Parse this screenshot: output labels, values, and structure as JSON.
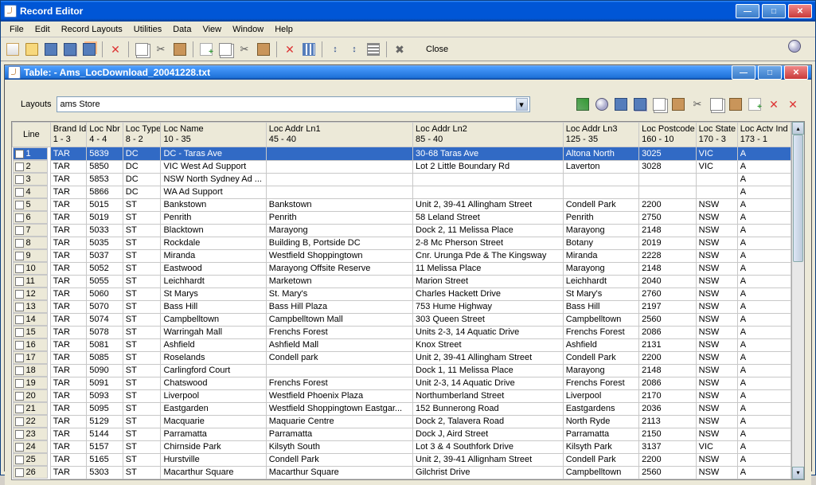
{
  "outerTitle": "Record Editor",
  "innerTitle": "Table: - Ams_LocDownload_20041228.txt",
  "menus": [
    "File",
    "Edit",
    "Record Layouts",
    "Utilities",
    "Data",
    "View",
    "Window",
    "Help"
  ],
  "toolbarGroups": [
    [
      "new-doc",
      "open-folder",
      "save",
      "save-as",
      "export"
    ],
    [
      "delete"
    ],
    [
      "copy",
      "cut",
      "paste"
    ],
    [
      "new-record",
      "copy-record",
      "cut-record",
      "paste-record"
    ],
    [
      "delete-record",
      "column-select"
    ],
    [
      "sort-asc",
      "sort-desc",
      "auto-fit"
    ],
    [
      "options"
    ]
  ],
  "closeLabel": "Close",
  "layoutsLabel": "Layouts",
  "layoutsValue": "ams Store",
  "rightTools": [
    "tree-view",
    "find",
    "save",
    "save-as",
    "copy",
    "paste",
    "cut",
    "copy-record",
    "paste-record",
    "new-record",
    "delete-record",
    "delete"
  ],
  "columns": [
    {
      "label": "Line",
      "sub": "",
      "w": 44
    },
    {
      "label": "Brand Id",
      "sub": "1 - 3",
      "w": 42
    },
    {
      "label": "Loc Nbr",
      "sub": "4 - 4",
      "w": 42
    },
    {
      "label": "Loc Type",
      "sub": "8 - 2",
      "w": 44
    },
    {
      "label": "Loc Name",
      "sub": "10 - 35",
      "w": 122
    },
    {
      "label": "Loc Addr Ln1",
      "sub": "45 - 40",
      "w": 170
    },
    {
      "label": "Loc Addr Ln2",
      "sub": "85 - 40",
      "w": 174
    },
    {
      "label": "Loc Addr Ln3",
      "sub": "125 - 35",
      "w": 88
    },
    {
      "label": "Loc Postcode",
      "sub": "160 - 10",
      "w": 66
    },
    {
      "label": "Loc State",
      "sub": "170 - 3",
      "w": 48
    },
    {
      "label": "Loc Actv Ind",
      "sub": "173 - 1",
      "w": 62
    }
  ],
  "rows": [
    {
      "n": 1,
      "sel": true,
      "c": [
        "TAR",
        "5839",
        "DC",
        "DC - Taras Ave",
        "",
        "30-68 Taras Ave",
        "Altona North",
        "3025",
        "VIC",
        "A"
      ]
    },
    {
      "n": 2,
      "c": [
        "TAR",
        "5850",
        "DC",
        "VIC West Ad Support",
        "",
        "Lot 2 Little Boundary Rd",
        "Laverton",
        "3028",
        "VIC",
        "A"
      ]
    },
    {
      "n": 3,
      "c": [
        "TAR",
        "5853",
        "DC",
        "NSW North Sydney Ad ...",
        "",
        "",
        "",
        "",
        "",
        "A"
      ]
    },
    {
      "n": 4,
      "c": [
        "TAR",
        "5866",
        "DC",
        "WA Ad Support",
        "",
        "",
        "",
        "",
        "",
        "A"
      ]
    },
    {
      "n": 5,
      "c": [
        "TAR",
        "5015",
        "ST",
        "Bankstown",
        "Bankstown",
        "Unit 2, 39-41 Allingham Street",
        "Condell Park",
        "2200",
        "NSW",
        "A"
      ]
    },
    {
      "n": 6,
      "c": [
        "TAR",
        "5019",
        "ST",
        "Penrith",
        "Penrith",
        "58 Leland Street",
        "Penrith",
        "2750",
        "NSW",
        "A"
      ]
    },
    {
      "n": 7,
      "c": [
        "TAR",
        "5033",
        "ST",
        "Blacktown",
        "Marayong",
        "Dock 2, 11 Melissa Place",
        "Marayong",
        "2148",
        "NSW",
        "A"
      ]
    },
    {
      "n": 8,
      "c": [
        "TAR",
        "5035",
        "ST",
        "Rockdale",
        "Building B,  Portside DC",
        "2-8 Mc Pherson Street",
        "Botany",
        "2019",
        "NSW",
        "A"
      ]
    },
    {
      "n": 9,
      "c": [
        "TAR",
        "5037",
        "ST",
        "Miranda",
        "Westfield Shoppingtown",
        "Cnr. Urunga Pde & The Kingsway",
        "Miranda",
        "2228",
        "NSW",
        "A"
      ]
    },
    {
      "n": 10,
      "c": [
        "TAR",
        "5052",
        "ST",
        "Eastwood",
        "Marayong Offsite Reserve",
        "11 Melissa Place",
        "Marayong",
        "2148",
        "NSW",
        "A"
      ]
    },
    {
      "n": 11,
      "c": [
        "TAR",
        "5055",
        "ST",
        "Leichhardt",
        "Marketown",
        "Marion Street",
        "Leichhardt",
        "2040",
        "NSW",
        "A"
      ]
    },
    {
      "n": 12,
      "c": [
        "TAR",
        "5060",
        "ST",
        "St Marys",
        "St. Mary's",
        "Charles Hackett Drive",
        "St Mary's",
        "2760",
        "NSW",
        "A"
      ]
    },
    {
      "n": 13,
      "c": [
        "TAR",
        "5070",
        "ST",
        "Bass Hill",
        "Bass Hill Plaza",
        "753 Hume Highway",
        "Bass Hill",
        "2197",
        "NSW",
        "A"
      ]
    },
    {
      "n": 14,
      "c": [
        "TAR",
        "5074",
        "ST",
        "Campbelltown",
        "Campbelltown Mall",
        "303 Queen Street",
        "Campbelltown",
        "2560",
        "NSW",
        "A"
      ]
    },
    {
      "n": 15,
      "c": [
        "TAR",
        "5078",
        "ST",
        "Warringah Mall",
        "Frenchs Forest",
        "Units 2-3, 14 Aquatic Drive",
        "Frenchs Forest",
        "2086",
        "NSW",
        "A"
      ]
    },
    {
      "n": 16,
      "c": [
        "TAR",
        "5081",
        "ST",
        "Ashfield",
        "Ashfield Mall",
        "Knox Street",
        "Ashfield",
        "2131",
        "NSW",
        "A"
      ]
    },
    {
      "n": 17,
      "c": [
        "TAR",
        "5085",
        "ST",
        "Roselands",
        "Condell park",
        "Unit 2, 39-41 Allingham Street",
        "Condell Park",
        "2200",
        "NSW",
        "A"
      ]
    },
    {
      "n": 18,
      "c": [
        "TAR",
        "5090",
        "ST",
        "Carlingford Court",
        "",
        "Dock 1, 11 Melissa Place",
        "Marayong",
        "2148",
        "NSW",
        "A"
      ]
    },
    {
      "n": 19,
      "c": [
        "TAR",
        "5091",
        "ST",
        "Chatswood",
        "Frenchs Forest",
        "Unit 2-3, 14 Aquatic Drive",
        "Frenchs Forest",
        "2086",
        "NSW",
        "A"
      ]
    },
    {
      "n": 20,
      "c": [
        "TAR",
        "5093",
        "ST",
        "Liverpool",
        "Westfield Phoenix Plaza",
        "Northumberland Street",
        "Liverpool",
        "2170",
        "NSW",
        "A"
      ]
    },
    {
      "n": 21,
      "c": [
        "TAR",
        "5095",
        "ST",
        "Eastgarden",
        "Westfield Shoppingtown Eastgar...",
        "152 Bunnerong Road",
        "Eastgardens",
        "2036",
        "NSW",
        "A"
      ]
    },
    {
      "n": 22,
      "c": [
        "TAR",
        "5129",
        "ST",
        "Macquarie",
        "Maquarie Centre",
        "Dock 2, Talavera Road",
        " North Ryde",
        "2113",
        "NSW",
        "A"
      ]
    },
    {
      "n": 23,
      "c": [
        "TAR",
        "5144",
        "ST",
        "Parramatta",
        "Parramatta",
        "Dock J, Aird Street",
        "Parramatta",
        "2150",
        "NSW",
        "A"
      ]
    },
    {
      "n": 24,
      "c": [
        "TAR",
        "5157",
        "ST",
        "Chirnside Park",
        "Kilsyth South",
        "Lot 3 & 4 Southfork Drive",
        "Kilsyth Park",
        "3137",
        "VIC",
        "A"
      ]
    },
    {
      "n": 25,
      "c": [
        "TAR",
        "5165",
        "ST",
        "Hurstville",
        "Condell Park",
        "Unit 2, 39-41 Allignham Street",
        "Condell Park",
        "2200",
        "NSW",
        "A"
      ]
    },
    {
      "n": 26,
      "c": [
        "TAR",
        "5303",
        "ST",
        "Macarthur Square",
        "Macarthur Square",
        "Gilchrist Drive",
        "Campbelltown",
        "2560",
        "NSW",
        "A"
      ]
    }
  ]
}
